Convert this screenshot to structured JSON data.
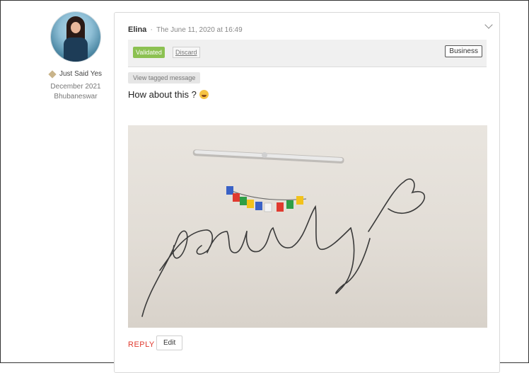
{
  "author": {
    "badge": "Just Said Yes",
    "date": "December 2021",
    "location": "Bhubaneswar"
  },
  "post": {
    "name": "Elina",
    "separator": "·",
    "date": "The June 11, 2020 at 16:49",
    "message": "How about this ?",
    "emoji": "grinning-face-icon"
  },
  "status": {
    "validated_label": "Validated",
    "discard_label": "Discard",
    "category_label": "Business"
  },
  "tagged_label": "View tagged message",
  "actions": {
    "reply_label": "REPLY",
    "edit_label": "Edit"
  },
  "colors": {
    "validated_bg": "#8cc152",
    "reply": "#e03a2f"
  }
}
